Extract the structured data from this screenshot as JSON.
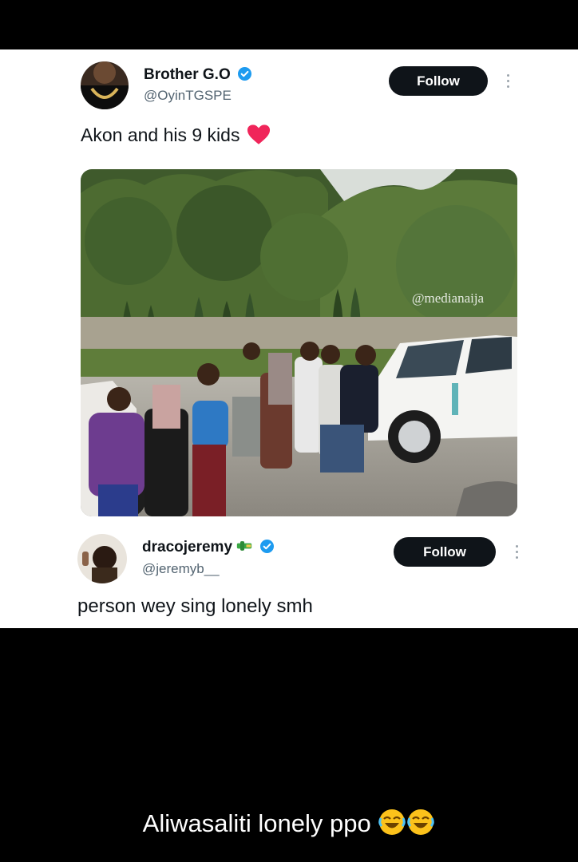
{
  "post1": {
    "name": "Brother G.O",
    "handle": "@OyinTGSPE",
    "follow_label": "Follow",
    "text": "Akon and his 9 kids",
    "text_emoji": "heart-emoji",
    "image_watermark": "@medianaija"
  },
  "post2": {
    "name": "dracojeremy",
    "name_emoji": "green-emoji",
    "handle": "@jeremyb__",
    "follow_label": "Follow",
    "text": "person wey sing lonely smh"
  },
  "caption": {
    "text": "Aliwasaliti  lonely ppo",
    "emoji": "rolling-laughing-emoji"
  },
  "colors": {
    "verified": "#1d9bf0",
    "follow_bg": "#0f1419",
    "handle": "#536471",
    "heart": "#f0255a"
  }
}
